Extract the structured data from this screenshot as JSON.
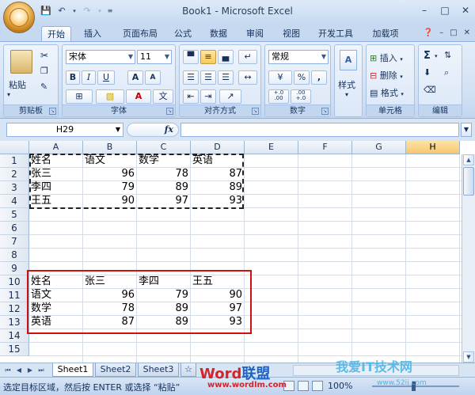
{
  "window": {
    "title": "Book1 - Microsoft Excel"
  },
  "tabs": [
    "开始",
    "插入",
    "页面布局",
    "公式",
    "数据",
    "审阅",
    "视图",
    "开发工具",
    "加载项"
  ],
  "ribbon": {
    "clipboard": {
      "label": "剪贴板",
      "paste": "粘贴"
    },
    "font": {
      "label": "字体",
      "font_name": "宋体",
      "font_size": "11",
      "bold": "B",
      "italic": "I",
      "underline": "U",
      "grow": "A",
      "shrink": "A",
      "font_color": "A"
    },
    "alignment": {
      "label": "对齐方式"
    },
    "number": {
      "label": "数字",
      "format": "常规",
      "percent": "%",
      "comma": ",",
      "inc_decimal": "+.0\n.00",
      "dec_decimal": ".00\n+.0"
    },
    "styles": {
      "label": "样式"
    },
    "cells": {
      "label": "单元格",
      "insert": "插入",
      "delete": "删除",
      "format": "格式"
    },
    "editing": {
      "label": "编辑",
      "sum": "Σ"
    }
  },
  "formula_bar": {
    "name_box": "H29",
    "fx": "fx",
    "formula": ""
  },
  "grid": {
    "columns": [
      "A",
      "B",
      "C",
      "D",
      "E",
      "F",
      "G",
      "H"
    ],
    "selected_column": "H",
    "rows": [
      "1",
      "2",
      "3",
      "4",
      "5",
      "6",
      "7",
      "8",
      "9",
      "10",
      "11",
      "12",
      "13",
      "14",
      "15"
    ],
    "source_table": {
      "header": [
        "姓名",
        "语文",
        "数学",
        "英语"
      ],
      "rows": [
        {
          "name": "张三",
          "values": [
            "96",
            "78",
            "87"
          ]
        },
        {
          "name": "李四",
          "values": [
            "79",
            "89",
            "89"
          ]
        },
        {
          "name": "王五",
          "values": [
            "90",
            "97",
            "93"
          ]
        }
      ]
    },
    "transposed_table": {
      "header": [
        "姓名",
        "张三",
        "李四",
        "王五"
      ],
      "rows": [
        {
          "name": "语文",
          "values": [
            "96",
            "79",
            "90"
          ]
        },
        {
          "name": "数学",
          "values": [
            "78",
            "89",
            "97"
          ]
        },
        {
          "name": "英语",
          "values": [
            "87",
            "89",
            "93"
          ]
        }
      ]
    }
  },
  "sheets": [
    "Sheet1",
    "Sheet2",
    "Sheet3"
  ],
  "active_sheet": "Sheet1",
  "status": {
    "message": "选定目标区域，然后按 ENTER 或选择 “粘贴”",
    "zoom": "100%"
  },
  "watermarks": {
    "brand1_w": "Word",
    "brand1_l": "联盟",
    "brand1_url": "www.wordlm.com",
    "brand2": "我爱IT技术网",
    "brand2_url": "www.52ij.com"
  },
  "colors": {
    "selection_marquee": "#222222",
    "red_box": "#d01010",
    "selected_header": "#f7c56a"
  }
}
